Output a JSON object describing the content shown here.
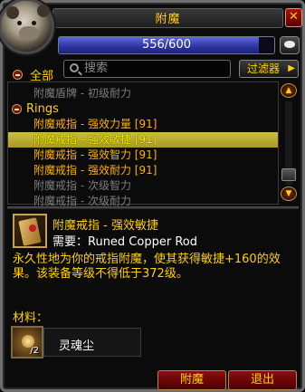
{
  "window": {
    "title": "附魔"
  },
  "rank": {
    "text": "556/600",
    "fraction": 0.927
  },
  "filter_bar": {
    "all_label": "全部",
    "search_placeholder": "搜索",
    "filter_button": "过滤器"
  },
  "recipes": [
    {
      "type": "item",
      "label": "附魔盾牌 - 初级耐力",
      "state": "disabled"
    },
    {
      "type": "header",
      "label": "Rings"
    },
    {
      "type": "item",
      "label": "附魔戒指 - 强效力量 [91]",
      "state": "orange"
    },
    {
      "type": "item",
      "label": "附魔戒指 - 强效敏捷 [91]",
      "state": "selected"
    },
    {
      "type": "item",
      "label": "附魔戒指 - 强效智力 [91]",
      "state": "orange"
    },
    {
      "type": "item",
      "label": "附魔戒指 - 强效耐力 [91]",
      "state": "orange"
    },
    {
      "type": "item",
      "label": "附魔戒指 - 次级智力",
      "state": "disabled"
    },
    {
      "type": "item",
      "label": "附魔戒指 - 次级耐力",
      "state": "disabled"
    }
  ],
  "detail": {
    "name": "附魔戒指 - 强效敏捷",
    "requires": "需要：Runed Copper Rod",
    "description": "永久性地为你的戒指附魔，使其获得敏捷+160的效果。该装备等级不得低于372级。",
    "reagents_label": "材料：",
    "reagent_name": "灵魂尘",
    "reagent_count": "/2"
  },
  "buttons": {
    "create": "附魔",
    "exit": "退出"
  }
}
